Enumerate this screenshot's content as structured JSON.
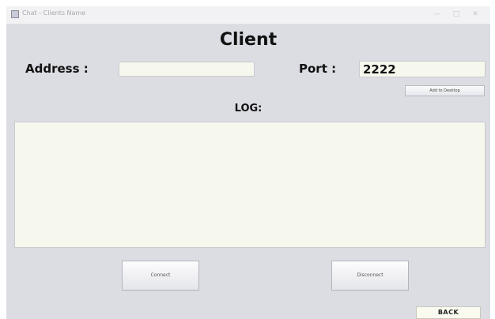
{
  "window": {
    "title": "Chat - Clients Name"
  },
  "header": {
    "title": "Client"
  },
  "connection": {
    "address_label": "Address :",
    "address_value": "",
    "port_label": "Port :",
    "port_value": "2222",
    "add_to_desktop_label": "Add to Desktop"
  },
  "log": {
    "label": "LOG:",
    "content": ""
  },
  "actions": {
    "connect_label": "Connect",
    "disconnect_label": "Disconnect",
    "back_label": "BACK"
  }
}
